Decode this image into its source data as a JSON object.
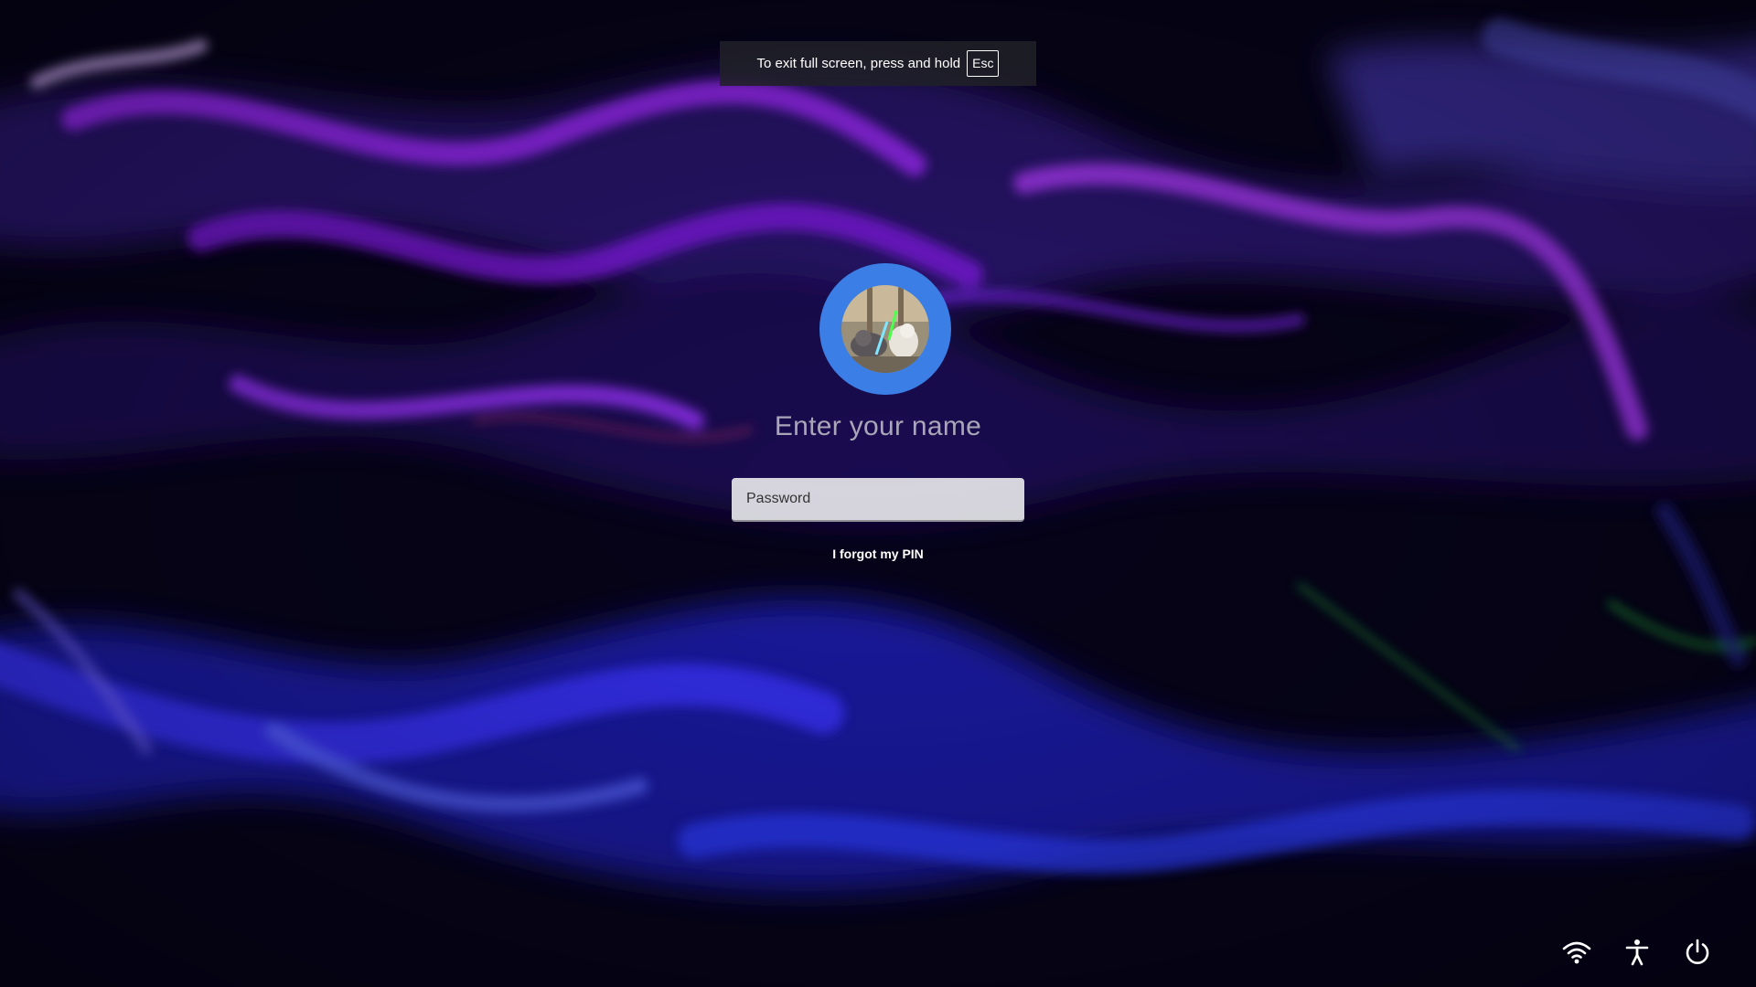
{
  "fullscreen_notice": {
    "message": "To exit full screen, press and hold",
    "key": "Esc"
  },
  "user": {
    "name_prompt": "Enter your name",
    "avatar_icon": "user-avatar-photo"
  },
  "password": {
    "placeholder": "Password",
    "value": ""
  },
  "forgot_pin": {
    "label": "I forgot my PIN"
  },
  "tray": {
    "network_icon": "wifi-icon",
    "accessibility_icon": "accessibility-icon",
    "power_icon": "power-icon"
  },
  "colors": {
    "avatar_ring": "#3b7fe6",
    "wallpaper_base": "#05030f",
    "wallpaper_accent_purple": "#9b1cff",
    "wallpaper_accent_blue": "#2a3cff"
  }
}
